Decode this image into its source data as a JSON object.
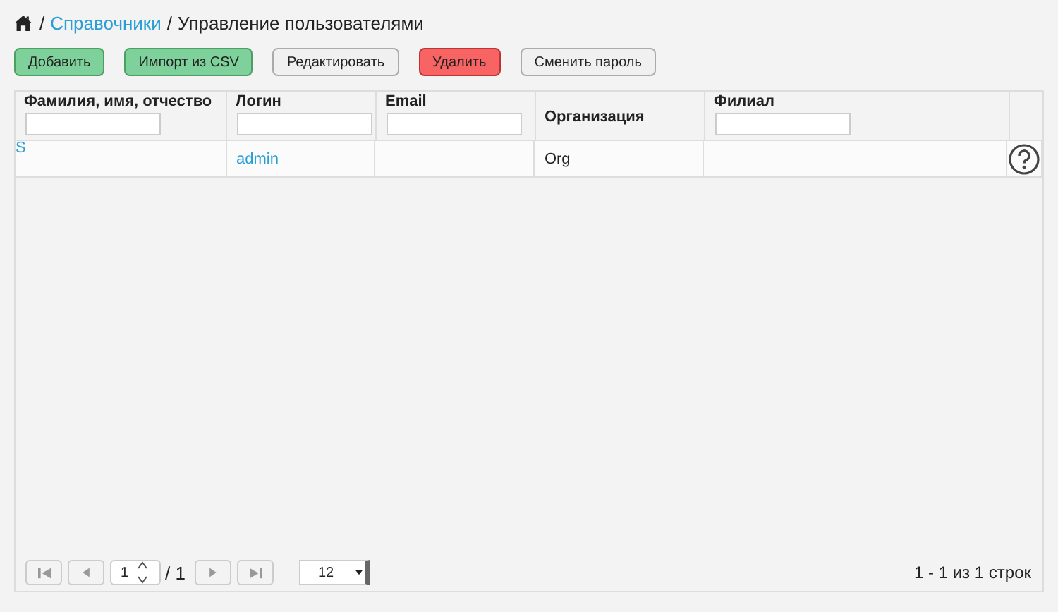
{
  "breadcrumb": {
    "separator": "/",
    "links": [
      {
        "label": "Справочники"
      }
    ],
    "current": "Управление пользователями"
  },
  "toolbar": [
    {
      "label": "Добавить",
      "kind": "success"
    },
    {
      "label": "Импорт из CSV",
      "kind": "success"
    },
    {
      "label": "Редактировать",
      "kind": "default"
    },
    {
      "label": "Удалить",
      "kind": "danger"
    },
    {
      "label": "Сменить пароль",
      "kind": "default"
    }
  ],
  "table": {
    "columns": [
      {
        "label": "Фамилия, имя, отчество",
        "filter": true
      },
      {
        "label": "Логин",
        "filter": true
      },
      {
        "label": "Email",
        "filter": true
      },
      {
        "label": "Организация",
        "filter": false
      },
      {
        "label": "Филиал",
        "filter": true
      }
    ],
    "rows": [
      {
        "cells": [
          {
            "text": "S",
            "link": true
          },
          {
            "text": "admin",
            "link": true
          },
          {},
          {
            "text": "Org",
            "link": false
          },
          {}
        ]
      }
    ]
  },
  "pager": {
    "page": "1",
    "total_pages": "/ 1",
    "page_size": "12",
    "summary": "1 - 1 из 1 строк"
  }
}
